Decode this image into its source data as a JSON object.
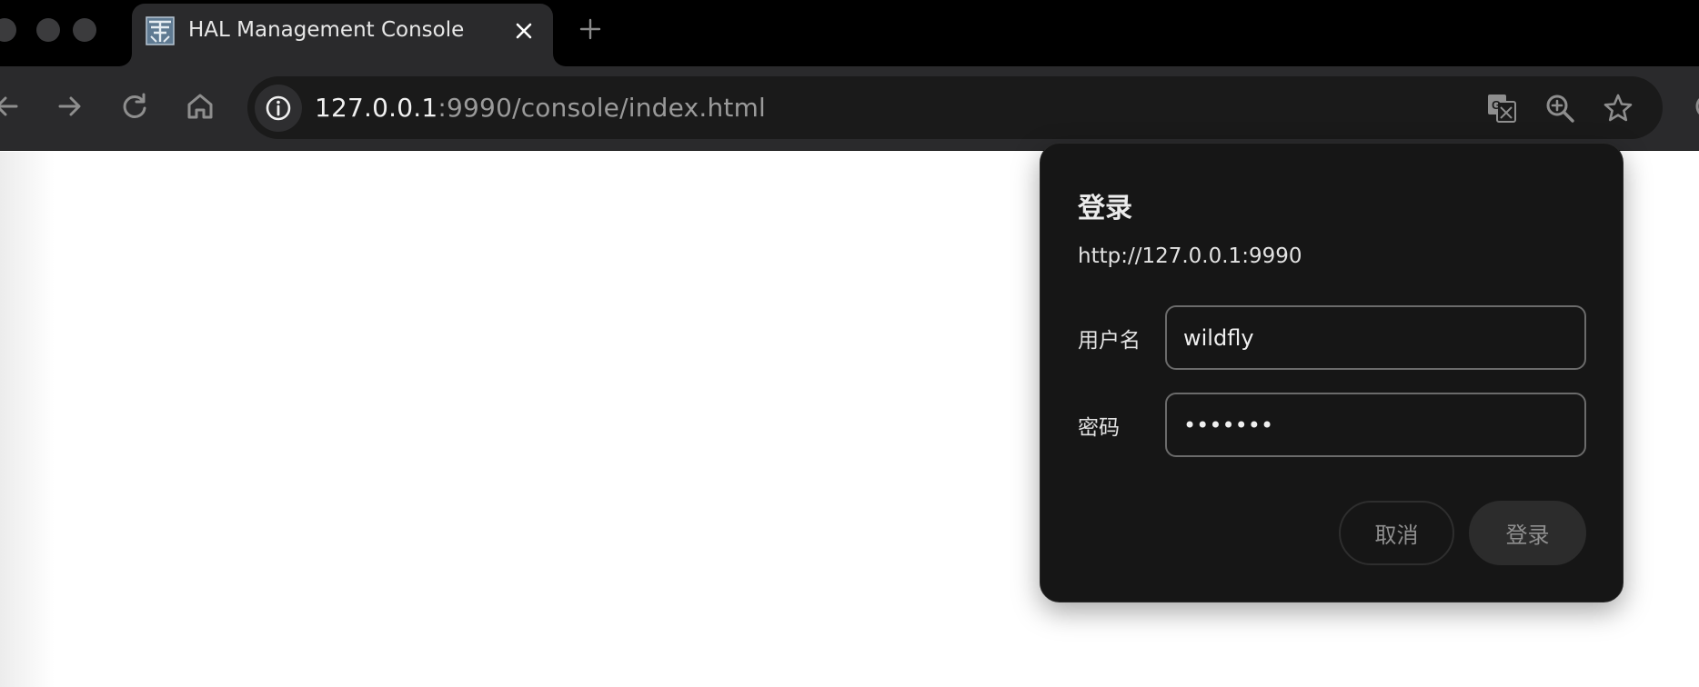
{
  "browser": {
    "tab": {
      "title": "HAL Management Console",
      "favicon": "hal-logo-icon",
      "close_icon": "close-icon"
    },
    "new_tab_icon": "plus-icon",
    "toolbar": {
      "back_icon": "arrow-left-icon",
      "forward_icon": "arrow-right-icon",
      "reload_icon": "reload-icon",
      "home_icon": "home-icon"
    },
    "address_bar": {
      "site_info_icon": "info-icon",
      "url_host": "127.0.0.1",
      "url_rest": ":9990/console/index.html",
      "translate_icon": "translate-icon",
      "zoom_icon": "zoom-in-icon",
      "bookmark_icon": "star-icon"
    }
  },
  "auth_dialog": {
    "title": "登录",
    "origin": "http://127.0.0.1:9990",
    "username": {
      "label": "用户名",
      "value": "wildfly"
    },
    "password": {
      "label": "密码",
      "value": "•••••••"
    },
    "cancel_label": "取消",
    "submit_label": "登录"
  },
  "colors": {
    "tab_strip": "#000000",
    "toolbar": "#2a2a2c",
    "omnibox": "#1a1a1a",
    "dialog_bg": "#161616",
    "dialog_text": "#e2e2e2"
  }
}
